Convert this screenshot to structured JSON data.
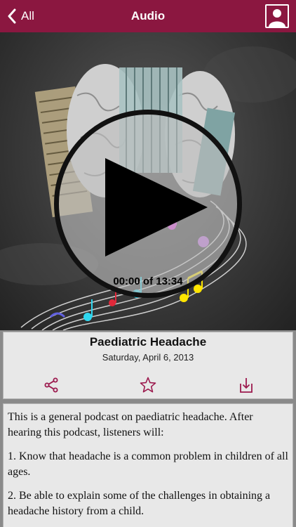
{
  "nav": {
    "back_label": "All",
    "title": "Audio"
  },
  "player": {
    "elapsed": "00:00",
    "separator": "of",
    "duration": "13:34"
  },
  "episode": {
    "title": "Paediatric Headache",
    "date": "Saturday, April 6, 2013"
  },
  "actions": {
    "share_icon": "share-icon",
    "favorite_icon": "star-icon",
    "download_icon": "download-icon"
  },
  "description": {
    "intro": "This is a general podcast on paediatric headache. After hearing this podcast, listeners will:",
    "points": [
      "1. Know that headache is a common problem in children of all ages.",
      "2. Be able to explain some of the challenges in obtaining a headache history from a child."
    ]
  },
  "colors": {
    "nav_background": "#8b1740",
    "accent": "#9c1a4e",
    "card_background": "#e8e8e8"
  }
}
